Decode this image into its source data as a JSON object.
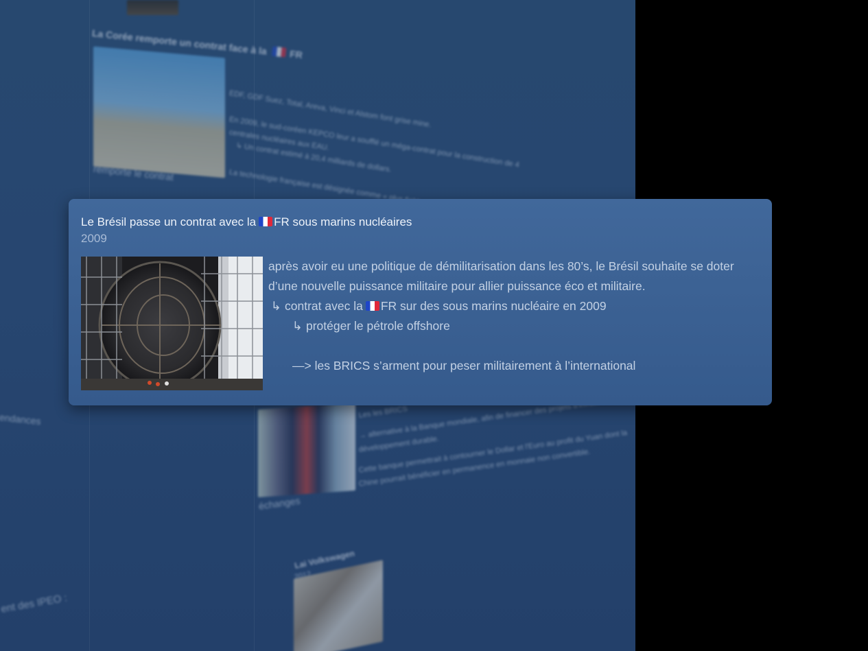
{
  "card": {
    "title_before_flag": "Le Brésil passe un contrat avec la",
    "title_after_flag": "FR sous marins nucléaires",
    "year": "2009",
    "image_icon": "shipyard-submarine-hull-photo",
    "lines": [
      {
        "prefix": "",
        "text": "après avoir eu une politique de démilitarisation dans les 80’s, le Brésil souhaite se doter"
      },
      {
        "prefix": "",
        "text": "d’une nouvelle puissance militaire pour allier puissance éco et militaire."
      },
      {
        "prefix": "↳",
        "text_before_flag": "contrat avec la",
        "text_after_flag": "FR sur des sous marins nucléaire en 2009"
      },
      {
        "prefix": "↳",
        "text": "protéger le pétrole offshore"
      },
      {
        "prefix": "",
        "text": "—> les BRICS s’arment pour peser militairement à l’international"
      }
    ]
  },
  "background": {
    "section_title": "La Corée remporte un contrat face à la",
    "section_title_suffix": "FR",
    "side_label_1": "remporte le contrat",
    "side_label_2": "endances",
    "side_label_3": "ent des IPEO :",
    "mid_label_1": "échanges",
    "plant_lines": [
      "EDF, GDF Suez, Total, Areva, Vinci et Alstom font grise mine.",
      "En 2009, le sud-coréen KEPCO leur a soufflé un méga-contrat pour la construction de 4",
      "centrales nucléaires aux EAU.",
      "↳ Un contrat estimé à 20,4 milliards de dollars.",
      "La technologie française est désignée comme « plus fiable »"
    ],
    "brics_lines": [
      "Les les BRICS",
      "→ alternative à la Banque mondiale, afin de financer des projets d'infrastructure et de",
      "développement durable.",
      "Cette banque permettrait à contourner le Dollar et l'Euro au profit du Yuan dont la",
      "Chine pourrait bénéficier en permanence en monnaie non convertible."
    ],
    "vw_title": "Lai Volkswagen",
    "vw_year": "2012",
    "colors": {
      "backdrop": "#274670",
      "card": "#3d6395",
      "outside": "#000000"
    }
  }
}
